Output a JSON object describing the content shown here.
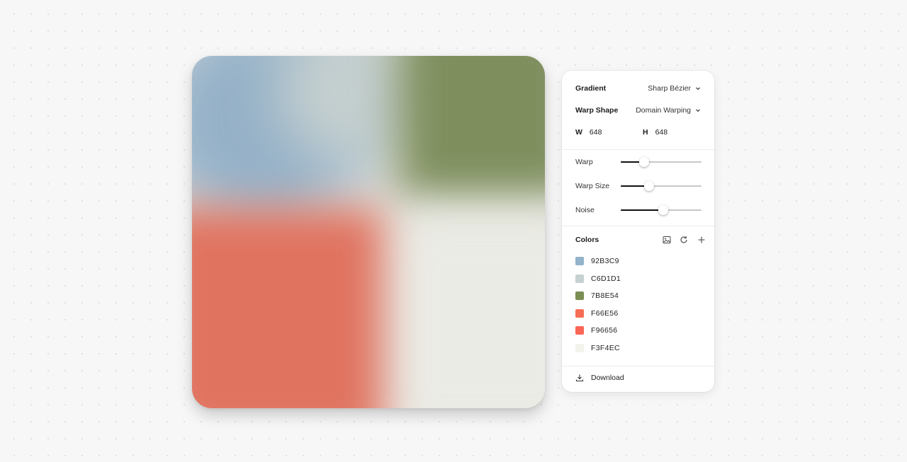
{
  "panel": {
    "gradient": {
      "label": "Gradient",
      "value": "Sharp Bézier"
    },
    "warp_shape": {
      "label": "Warp Shape",
      "value": "Domain Warping"
    },
    "dimensions": {
      "w_label": "W",
      "w_value": "648",
      "h_label": "H",
      "h_value": "648"
    },
    "sliders": [
      {
        "label": "Warp",
        "value": 0.29
      },
      {
        "label": "Warp Size",
        "value": 0.35
      },
      {
        "label": "Noise",
        "value": 0.53
      }
    ],
    "colors": {
      "label": "Colors",
      "items": [
        {
          "hex": "92B3C9",
          "color": "#92B3C9"
        },
        {
          "hex": "C6D1D1",
          "color": "#C6D1D1"
        },
        {
          "hex": "7B8E54",
          "color": "#7B8E54"
        },
        {
          "hex": "F66E56",
          "color": "#F66E56"
        },
        {
          "hex": "F96656",
          "color": "#F96656"
        },
        {
          "hex": "F3F4EC",
          "color": "#F3F4EC"
        }
      ]
    },
    "download_label": "Download"
  },
  "icons": {
    "gradient_dropdown": "chevron-down-icon",
    "warp_dropdown": "chevron-down-icon",
    "image": "image-icon",
    "refresh": "refresh-icon",
    "add": "plus-icon",
    "download": "download-icon"
  }
}
